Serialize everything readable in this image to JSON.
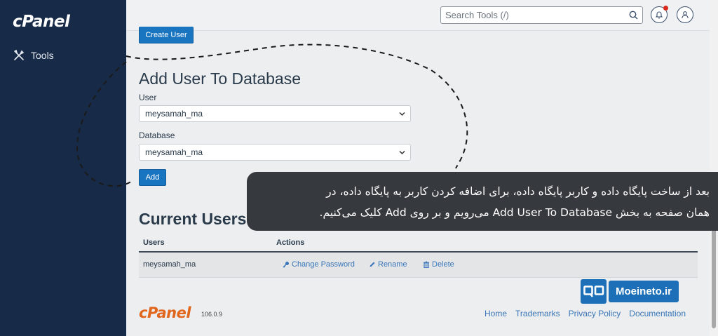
{
  "sidebar": {
    "logo": "cPanel",
    "tools_label": "Tools"
  },
  "topbar": {
    "search_placeholder": "Search Tools (/)"
  },
  "create_user_button": "Create User",
  "add_user_section": {
    "title": "Add User To Database",
    "user_label": "User",
    "user_selected": "meysamah_ma",
    "database_label": "Database",
    "database_selected": "meysamah_ma",
    "add_button": "Add"
  },
  "current_users": {
    "title": "Current Users",
    "columns": [
      "Users",
      "Actions"
    ],
    "rows": [
      {
        "user": "meysamah_ma",
        "actions": [
          "Change Password",
          "Rename",
          "Delete"
        ]
      }
    ]
  },
  "footer": {
    "logo": "cPanel",
    "version": "106.0.9",
    "links": [
      "Home",
      "Trademarks",
      "Privacy Policy",
      "Documentation"
    ]
  },
  "watermark": {
    "icon_text": "QO",
    "text": "Moeineto.ir"
  },
  "caption": {
    "line1": "بعد از ساخت پایگاه داده و کاربر پایگاه داده، برای اضافه کردن کاربر به پایگاه داده، در",
    "line2": "همان صفحه به بخش Add User To Database می‌رویم و بر روی Add کلیک می‌کنیم."
  },
  "colors": {
    "sidebar": "#172a47",
    "button": "#1a75c1",
    "link": "#3a76b8",
    "logo_footer": "#e2651c",
    "caption_bg": "#36393d",
    "badge": "#1d70b7"
  }
}
